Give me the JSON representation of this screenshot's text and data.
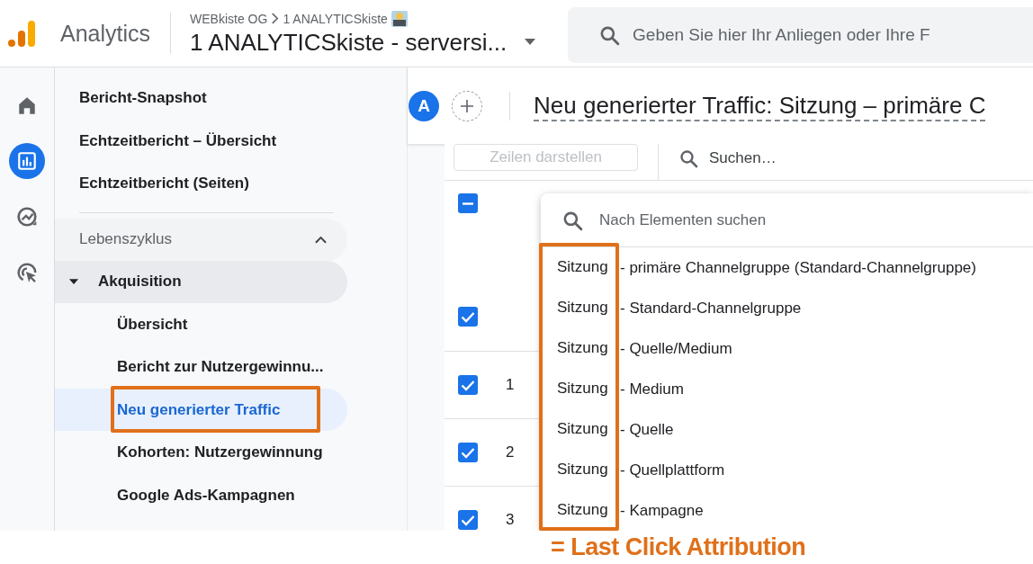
{
  "header": {
    "product": "Analytics",
    "breadcrumb": [
      "WEBkiste OG",
      "1 ANALYTICSkiste"
    ],
    "property": "1 ANALYTICSkiste - serversi...",
    "search": {
      "placeholder": "Geben Sie hier Ihr Anliegen oder Ihre F"
    }
  },
  "rail": [
    {
      "kind": "home",
      "selected": false
    },
    {
      "kind": "reports",
      "selected": true
    },
    {
      "kind": "explore",
      "selected": false
    },
    {
      "kind": "advertising",
      "selected": false
    }
  ],
  "sidebar": {
    "items": [
      {
        "label": "Bericht-Snapshot",
        "selected": false
      },
      {
        "label": "Echtzeitbericht – Übersicht",
        "selected": false
      },
      {
        "label": "Echtzeitbericht (Seiten)",
        "selected": false
      }
    ],
    "section": {
      "label": "Lebenszyklus",
      "expanded": true,
      "children": [
        {
          "label": "Akquisition",
          "expanded": true,
          "children": [
            {
              "label": "Übersicht",
              "selected": false,
              "highlighted": false
            },
            {
              "label": "Bericht zur Nutzergewinnu...",
              "selected": false,
              "highlighted": false
            },
            {
              "label": "Neu generierter Traffic",
              "selected": true,
              "highlighted": true
            },
            {
              "label": "Kohorten: Nutzergewinnung",
              "selected": false,
              "highlighted": false
            },
            {
              "label": "Google Ads-Kampagnen",
              "selected": false,
              "highlighted": false
            }
          ]
        }
      ]
    }
  },
  "report": {
    "comparison": {
      "avatar": "A"
    },
    "title": "Neu generierter Traffic: Sitzung – primäre C",
    "toolbar": {
      "rows_button": {
        "label": "Zeilen darstellen",
        "disabled": true
      },
      "search": {
        "placeholder": "Suchen…"
      }
    },
    "header_checkbox": {
      "indeterminate": true
    },
    "rows": [
      {
        "checked": true
      },
      {
        "number": "1",
        "checked": true
      },
      {
        "number": "2",
        "checked": true
      },
      {
        "number": "3",
        "checked": true
      }
    ]
  },
  "dropdown": {
    "search": {
      "placeholder": "Nach Elementen suchen"
    },
    "prefix_highlighted": true,
    "items": [
      {
        "prefix": "Sitzung",
        "label": "- primäre Channelgruppe (Standard-Channelgruppe)"
      },
      {
        "prefix": "Sitzung",
        "label": "- Standard-Channelgruppe"
      },
      {
        "prefix": "Sitzung",
        "label": "- Quelle/Medium"
      },
      {
        "prefix": "Sitzung",
        "label": "- Medium"
      },
      {
        "prefix": "Sitzung",
        "label": "- Quelle"
      },
      {
        "prefix": "Sitzung",
        "label": "- Quellplattform"
      },
      {
        "prefix": "Sitzung",
        "label": "- Kampagne"
      }
    ]
  },
  "annotation": {
    "text": "= Last Click Attribution"
  }
}
